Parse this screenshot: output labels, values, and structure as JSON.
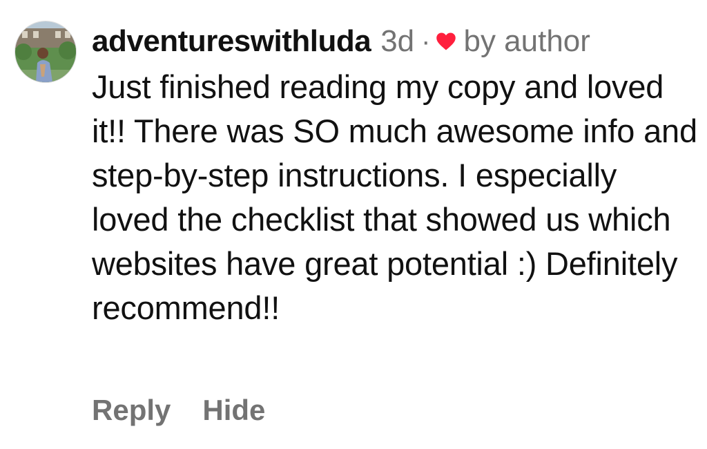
{
  "comment": {
    "username": "adventureswithluda",
    "time": "3d",
    "separator": "·",
    "liked_by": "by author",
    "heart_icon": "heart-icon",
    "heart_color": "#ff1f3d",
    "text": "Just finished reading my copy and loved it!! There was SO much awesome info and step-by-step instructions. I especially loved the checklist that showed us which websites have great potential :) Definitely recommend!!"
  },
  "actions": {
    "reply_label": "Reply",
    "hide_label": "Hide"
  }
}
